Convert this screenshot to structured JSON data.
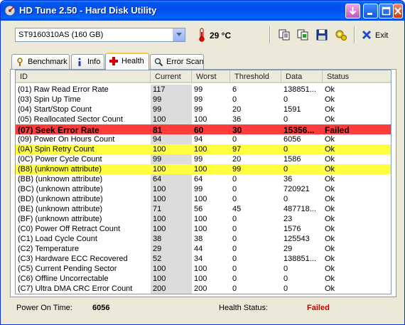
{
  "window": {
    "title": "HD Tune 2.50 - Hard Disk Utility",
    "minimize": "minimize",
    "maximize": "maximize",
    "close": "close"
  },
  "toolbar": {
    "drive": "ST9160310AS (160 GB)",
    "temperature": "29 °C",
    "exit_label": "Exit",
    "icons": [
      "copy-icon",
      "copy-text-icon",
      "save-icon",
      "options-icon",
      "exit-icon"
    ]
  },
  "tabs": [
    {
      "label": "Benchmark",
      "icon": "benchmark-icon",
      "active": false
    },
    {
      "label": "Info",
      "icon": "info-icon",
      "active": false
    },
    {
      "label": "Health",
      "icon": "health-icon",
      "active": true
    },
    {
      "label": "Error Scan",
      "icon": "error-scan-icon",
      "active": false
    }
  ],
  "table": {
    "columns": [
      "ID",
      "Current",
      "Worst",
      "Threshold",
      "Data",
      "Status"
    ],
    "rows": [
      {
        "id": "(01) Raw Read Error Rate",
        "current": "117",
        "worst": "99",
        "threshold": "6",
        "data": "138851...",
        "status": "Ok",
        "state": "ok"
      },
      {
        "id": "(03) Spin Up Time",
        "current": "99",
        "worst": "99",
        "threshold": "0",
        "data": "0",
        "status": "Ok",
        "state": "ok"
      },
      {
        "id": "(04) Start/Stop Count",
        "current": "99",
        "worst": "99",
        "threshold": "20",
        "data": "1591",
        "status": "Ok",
        "state": "ok"
      },
      {
        "id": "(05) Reallocated Sector Count",
        "current": "100",
        "worst": "100",
        "threshold": "36",
        "data": "0",
        "status": "Ok",
        "state": "ok"
      },
      {
        "id": "(07) Seek Error Rate",
        "current": "81",
        "worst": "60",
        "threshold": "30",
        "data": "15356...",
        "status": "Failed",
        "state": "failed"
      },
      {
        "id": "(09) Power On Hours Count",
        "current": "94",
        "worst": "94",
        "threshold": "0",
        "data": "6056",
        "status": "Ok",
        "state": "ok"
      },
      {
        "id": "(0A) Spin Retry Count",
        "current": "100",
        "worst": "100",
        "threshold": "97",
        "data": "0",
        "status": "Ok",
        "state": "warn"
      },
      {
        "id": "(0C) Power Cycle Count",
        "current": "99",
        "worst": "99",
        "threshold": "20",
        "data": "1586",
        "status": "Ok",
        "state": "ok"
      },
      {
        "id": "(B8) (unknown attribute)",
        "current": "100",
        "worst": "100",
        "threshold": "99",
        "data": "0",
        "status": "Ok",
        "state": "warn"
      },
      {
        "id": "(BB) (unknown attribute)",
        "current": "64",
        "worst": "64",
        "threshold": "0",
        "data": "36",
        "status": "Ok",
        "state": "ok"
      },
      {
        "id": "(BC) (unknown attribute)",
        "current": "100",
        "worst": "99",
        "threshold": "0",
        "data": "720921",
        "status": "Ok",
        "state": "ok"
      },
      {
        "id": "(BD) (unknown attribute)",
        "current": "100",
        "worst": "100",
        "threshold": "0",
        "data": "0",
        "status": "Ok",
        "state": "ok"
      },
      {
        "id": "(BE) (unknown attribute)",
        "current": "71",
        "worst": "56",
        "threshold": "45",
        "data": "487718...",
        "status": "Ok",
        "state": "ok"
      },
      {
        "id": "(BF) (unknown attribute)",
        "current": "100",
        "worst": "100",
        "threshold": "0",
        "data": "23",
        "status": "Ok",
        "state": "ok"
      },
      {
        "id": "(C0) Power Off Retract Count",
        "current": "100",
        "worst": "100",
        "threshold": "0",
        "data": "1576",
        "status": "Ok",
        "state": "ok"
      },
      {
        "id": "(C1) Load Cycle Count",
        "current": "38",
        "worst": "38",
        "threshold": "0",
        "data": "125543",
        "status": "Ok",
        "state": "ok"
      },
      {
        "id": "(C2) Temperature",
        "current": "29",
        "worst": "44",
        "threshold": "0",
        "data": "29",
        "status": "Ok",
        "state": "ok"
      },
      {
        "id": "(C3) Hardware ECC Recovered",
        "current": "52",
        "worst": "34",
        "threshold": "0",
        "data": "138851...",
        "status": "Ok",
        "state": "ok"
      },
      {
        "id": "(C5) Current Pending Sector",
        "current": "100",
        "worst": "100",
        "threshold": "0",
        "data": "0",
        "status": "Ok",
        "state": "ok"
      },
      {
        "id": "(C6) Offline Uncorrectable",
        "current": "100",
        "worst": "100",
        "threshold": "0",
        "data": "0",
        "status": "Ok",
        "state": "ok"
      },
      {
        "id": "(C7) Ultra DMA CRC Error Count",
        "current": "200",
        "worst": "200",
        "threshold": "0",
        "data": "0",
        "status": "Ok",
        "state": "ok"
      }
    ]
  },
  "statusbar": {
    "power_on_label": "Power On Time:",
    "power_on_value": "6056",
    "health_label": "Health Status:",
    "health_value": "Failed"
  },
  "colors": {
    "failed_row": "#ff3b3b",
    "warn_row": "#ffff40",
    "failed_text": "#c00000"
  }
}
